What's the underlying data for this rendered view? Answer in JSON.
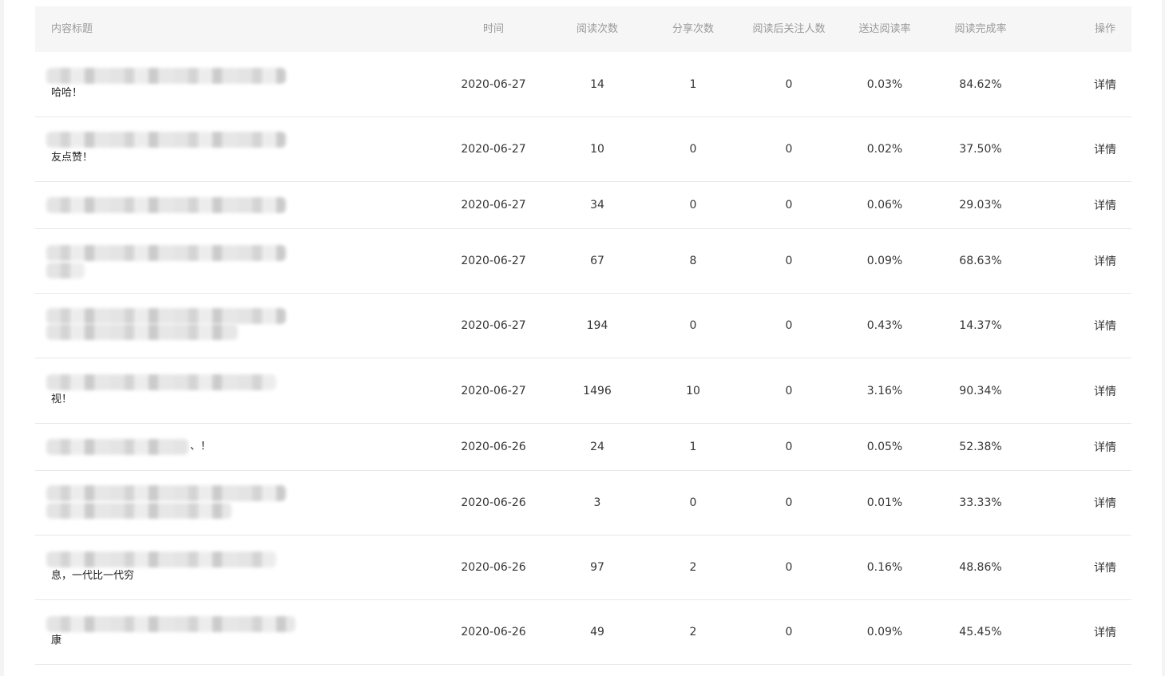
{
  "table": {
    "headers": {
      "title": "内容标题",
      "time": "时间",
      "reads": "阅读次数",
      "shares": "分享次数",
      "follows": "阅读后关注人数",
      "deliver_rate": "送达阅读率",
      "complete_rate": "阅读完成率",
      "action": "操作"
    },
    "rows": [
      {
        "title_visible": "哈哈！",
        "time": "2020-06-27",
        "reads": "14",
        "shares": "1",
        "follows": "0",
        "deliver_rate": "0.03%",
        "complete_rate": "84.62%",
        "action": "详情"
      },
      {
        "title_visible": "友点赞！",
        "time": "2020-06-27",
        "reads": "10",
        "shares": "0",
        "follows": "0",
        "deliver_rate": "0.02%",
        "complete_rate": "37.50%",
        "action": "详情"
      },
      {
        "title_visible": "",
        "time": "2020-06-27",
        "reads": "34",
        "shares": "0",
        "follows": "0",
        "deliver_rate": "0.06%",
        "complete_rate": "29.03%",
        "action": "详情"
      },
      {
        "title_visible": "",
        "time": "2020-06-27",
        "reads": "67",
        "shares": "8",
        "follows": "0",
        "deliver_rate": "0.09%",
        "complete_rate": "68.63%",
        "action": "详情"
      },
      {
        "title_visible": "",
        "time": "2020-06-27",
        "reads": "194",
        "shares": "0",
        "follows": "0",
        "deliver_rate": "0.43%",
        "complete_rate": "14.37%",
        "action": "详情"
      },
      {
        "title_visible": "视！",
        "time": "2020-06-27",
        "reads": "1496",
        "shares": "10",
        "follows": "0",
        "deliver_rate": "3.16%",
        "complete_rate": "90.34%",
        "action": "详情"
      },
      {
        "title_visible": "、！",
        "time": "2020-06-26",
        "reads": "24",
        "shares": "1",
        "follows": "0",
        "deliver_rate": "0.05%",
        "complete_rate": "52.38%",
        "action": "详情"
      },
      {
        "title_visible": "",
        "time": "2020-06-26",
        "reads": "3",
        "shares": "0",
        "follows": "0",
        "deliver_rate": "0.01%",
        "complete_rate": "33.33%",
        "action": "详情"
      },
      {
        "title_visible": "息，一代比一代穷",
        "time": "2020-06-26",
        "reads": "97",
        "shares": "2",
        "follows": "0",
        "deliver_rate": "0.16%",
        "complete_rate": "48.86%",
        "action": "详情"
      },
      {
        "title_visible": "康",
        "time": "2020-06-26",
        "reads": "49",
        "shares": "2",
        "follows": "0",
        "deliver_rate": "0.09%",
        "complete_rate": "45.45%",
        "action": "详情"
      }
    ]
  },
  "colors": {
    "header_bg": "#f6f6f6",
    "header_text": "#999999",
    "row_border": "#e8e8e8",
    "link": "#5a7ca6"
  }
}
